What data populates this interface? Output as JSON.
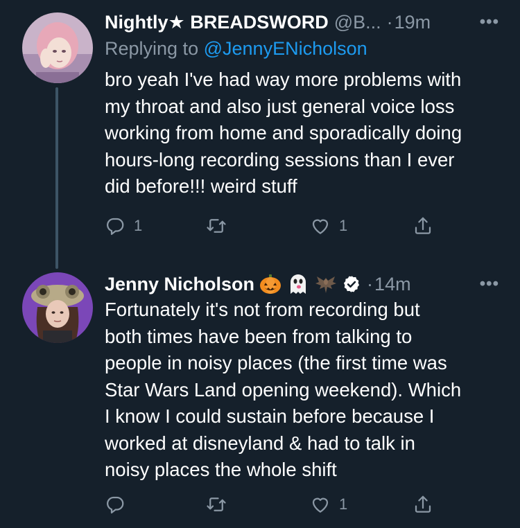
{
  "colors": {
    "background": "#15202b",
    "secondary_text": "#8b98a5",
    "link": "#1d9bf0",
    "verified": "#ffffff"
  },
  "tweets": [
    {
      "display_name": "Nightly★ BREADSWORD",
      "handle": "@B...",
      "separator": "·",
      "time": "19m",
      "more": "•••",
      "reply_prefix": "Replying to",
      "reply_mention": "@JennyENicholson",
      "body_lines": [
        "bro yeah I've had way more problems with",
        "my throat and also just general voice loss",
        "working from home and sporadically doing",
        "hours-long recording sessions than I ever",
        "did before!!! weird stuff"
      ],
      "actions": {
        "reply_icon": "reply-icon",
        "reply_count": "1",
        "retweet_icon": "retweet-icon",
        "retweet_count": "",
        "like_icon": "heart-icon",
        "like_count": "1",
        "share_icon": "share-icon"
      }
    },
    {
      "display_name": "Jenny Nicholson",
      "emojis": [
        "pumpkin-emoji",
        "ghost-emoji",
        "bat-emoji"
      ],
      "verified_icon": "verified-badge-icon",
      "separator": "·",
      "time": "14m",
      "more": "•••",
      "body_lines": [
        "Fortunately it's not from recording but",
        "both times have been from talking to",
        "people in noisy places (the first time was",
        "Star Wars Land opening weekend). Which",
        "I know I could sustain before because I",
        "worked at disneyland & had to talk in",
        "noisy places the whole shift"
      ],
      "actions": {
        "reply_icon": "reply-icon",
        "reply_count": "",
        "retweet_icon": "retweet-icon",
        "retweet_count": "",
        "like_icon": "heart-icon",
        "like_count": "1",
        "share_icon": "share-icon"
      }
    }
  ]
}
